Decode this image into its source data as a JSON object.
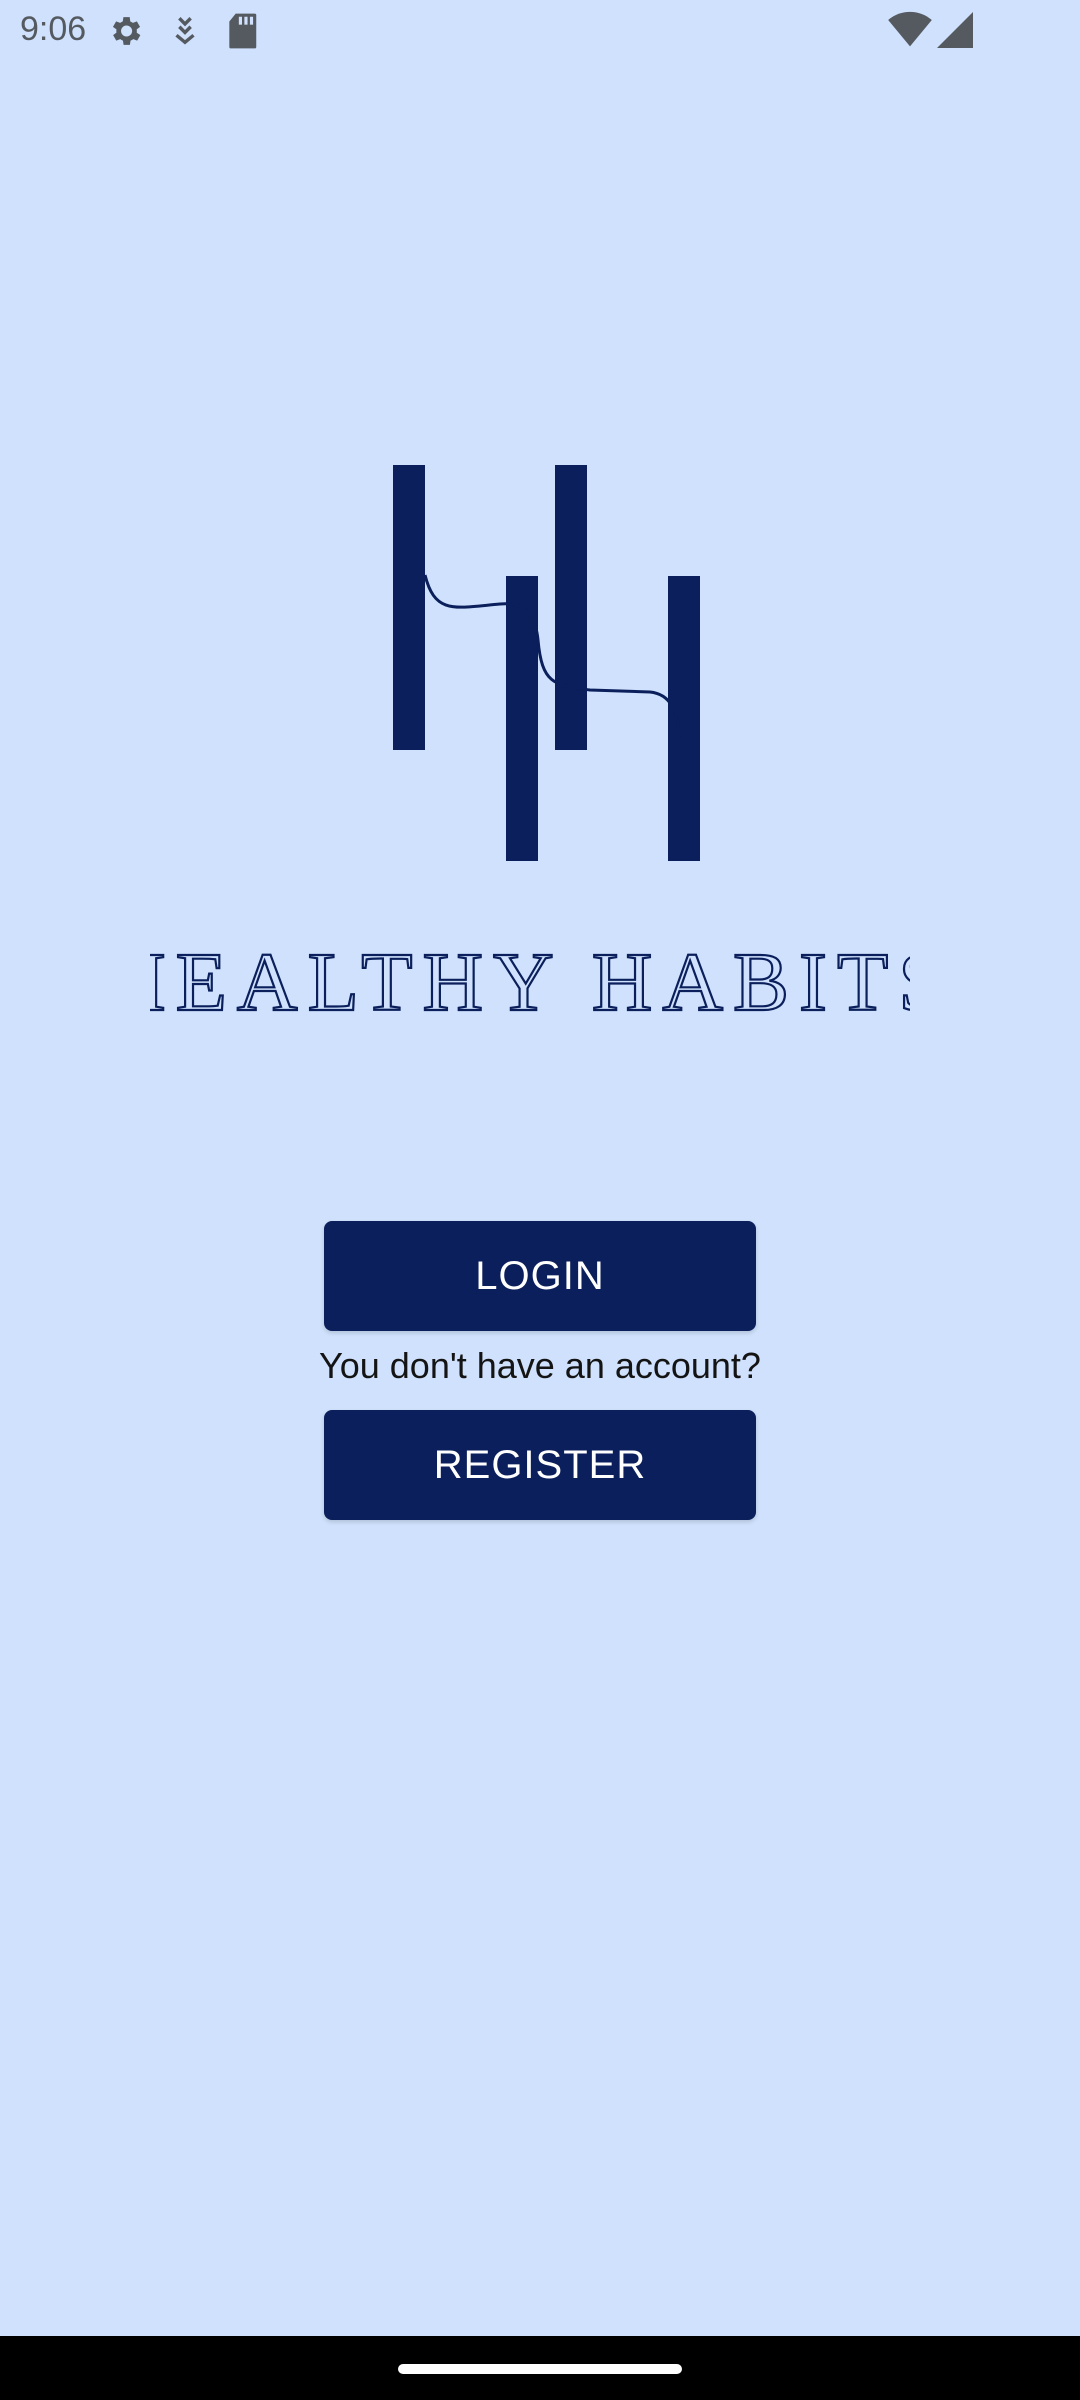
{
  "status_bar": {
    "time": "9:06",
    "left_icons": [
      "gear-icon",
      "download-icon",
      "sd-card-icon"
    ],
    "right_icons": [
      "wifi-icon",
      "cell-signal-icon"
    ]
  },
  "brand": {
    "logo_icon": "hh-monogram-logo",
    "name": "HEALTHY HABITS",
    "color": "#0a1f5b"
  },
  "auth": {
    "login_label": "LOGIN",
    "prompt": "You don't have an account?",
    "register_label": "REGISTER"
  },
  "colors": {
    "background": "#cfe1fc",
    "button": "#0a1f5b",
    "button_text": "#ffffff"
  }
}
